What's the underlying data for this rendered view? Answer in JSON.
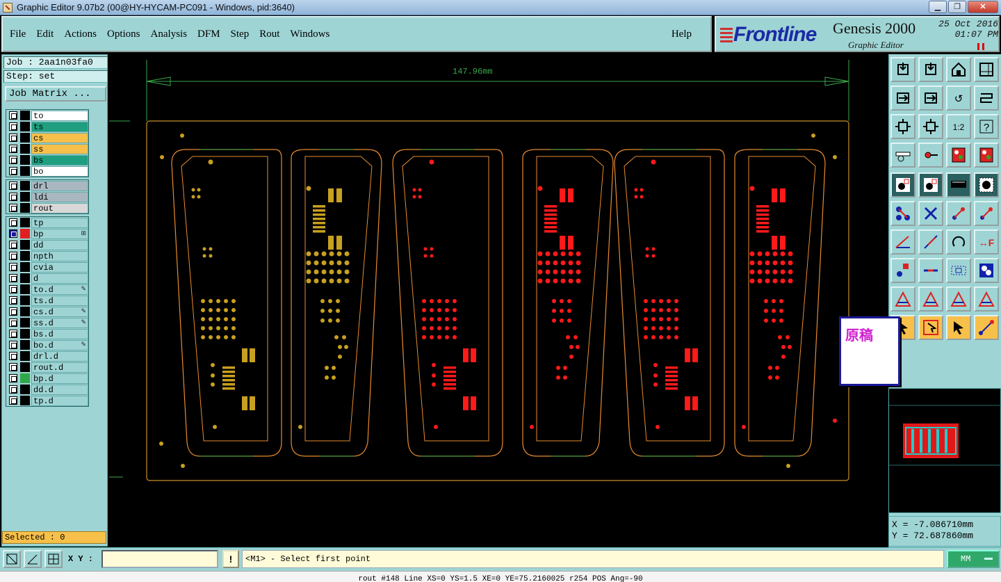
{
  "window": {
    "title": "Graphic Editor 9.07b2 (00@HY-HYCAM-PC091 - Windows, pid:3640)"
  },
  "menu": {
    "items": [
      "File",
      "Edit",
      "Actions",
      "Options",
      "Analysis",
      "DFM",
      "Step",
      "Rout",
      "Windows"
    ],
    "help": "Help"
  },
  "brand": {
    "logo": "Frontline",
    "product": "Genesis 2000",
    "subtitle": "Graphic Editor",
    "date": "25 Oct 2016",
    "time": "01:07 PM"
  },
  "job": {
    "job_line": "Job : 2aa1n03fa0",
    "step_line": "Step: set",
    "matrix_button": "Job Matrix ..."
  },
  "layers": {
    "group1": [
      {
        "name": "to",
        "color": "#ffffff"
      },
      {
        "name": "ts",
        "color": "#1f9f7f"
      },
      {
        "name": "cs",
        "color": "#f7c04a"
      },
      {
        "name": "ss",
        "color": "#f7c04a"
      },
      {
        "name": "bs",
        "color": "#1f9f7f"
      },
      {
        "name": "bo",
        "color": "#ffffff"
      }
    ],
    "group2": [
      {
        "name": "drl",
        "color": "#a9b8c0"
      },
      {
        "name": "ldi",
        "color": "#a9b8c0"
      },
      {
        "name": "rout",
        "color": "#d8d8d8"
      }
    ],
    "group3": [
      {
        "name": "tp",
        "color": "#9fd4d4"
      },
      {
        "name": "bp",
        "color": "#9fd4d4",
        "active": true,
        "swatch": "#e02020",
        "mark": "⊞"
      },
      {
        "name": "dd",
        "color": "#9fd4d4"
      },
      {
        "name": "npth",
        "color": "#9fd4d4"
      },
      {
        "name": "cvia",
        "color": "#9fd4d4"
      },
      {
        "name": "d",
        "color": "#9fd4d4"
      },
      {
        "name": "to.d",
        "color": "#9fd4d4",
        "mark": "✎"
      },
      {
        "name": "ts.d",
        "color": "#9fd4d4"
      },
      {
        "name": "cs.d",
        "color": "#9fd4d4",
        "mark": "✎"
      },
      {
        "name": "ss.d",
        "color": "#9fd4d4",
        "mark": "✎"
      },
      {
        "name": "bs.d",
        "color": "#9fd4d4"
      },
      {
        "name": "bo.d",
        "color": "#9fd4d4",
        "mark": "✎"
      },
      {
        "name": "drl.d",
        "color": "#9fd4d4"
      },
      {
        "name": "rout.d",
        "color": "#9fd4d4"
      },
      {
        "name": "bp.d",
        "color": "#9fd4d4",
        "swatch": "#2fa84a"
      },
      {
        "name": "dd.d",
        "color": "#9fd4d4"
      },
      {
        "name": "tp.d",
        "color": "#9fd4d4"
      }
    ]
  },
  "selected": "Selected : 0",
  "canvas": {
    "dimension_label": "147.96mm",
    "colors": {
      "profile": "#c8902a",
      "copper": "#c8a020",
      "red": "#ff1a1a",
      "outline": "#e88c30",
      "dim": "#3aa84a"
    }
  },
  "popup": {
    "text": "原稿"
  },
  "coords": {
    "x": "X = -7.086710mm",
    "y": "Y = 72.687860mm"
  },
  "bottom": {
    "xy_label": "X Y :",
    "xy_value": "",
    "bang": "!",
    "prompt": "<M1> - Select first point",
    "units": "MM"
  },
  "status": "rout #148 Line XS=0 YS=1.5 XE=0 YE=75.2160025 r254 POS Ang=-90",
  "toolbar": {
    "icons": [
      "snap-top-icon",
      "snap-bottom-icon",
      "home-icon",
      "window-icon",
      "move-left-icon",
      "move-right-icon",
      "rotate-icon",
      "snake-icon",
      "fit-icon",
      "center-icon",
      "scale-icon",
      "help-icon",
      "measure-icon",
      "probe-icon",
      "traffic-red-icon",
      "traffic-stop-icon",
      "select-pad-icon",
      "select-poly-icon",
      "ruler-icon",
      "dot-icon",
      "net-icon",
      "cross-icon",
      "connect-icon",
      "connect-red-icon",
      "angle-icon",
      "line-icon",
      "arc-icon",
      "flip-icon",
      "feature-icon",
      "bar-icon",
      "box-icon",
      "cluster-icon",
      "triangle-icon",
      "triangle-up-icon",
      "triangle-a-icon",
      "triangle-b-icon",
      "arrow-orange-icon",
      "box-arrow-icon",
      "cursor-icon",
      "node-icon"
    ]
  }
}
